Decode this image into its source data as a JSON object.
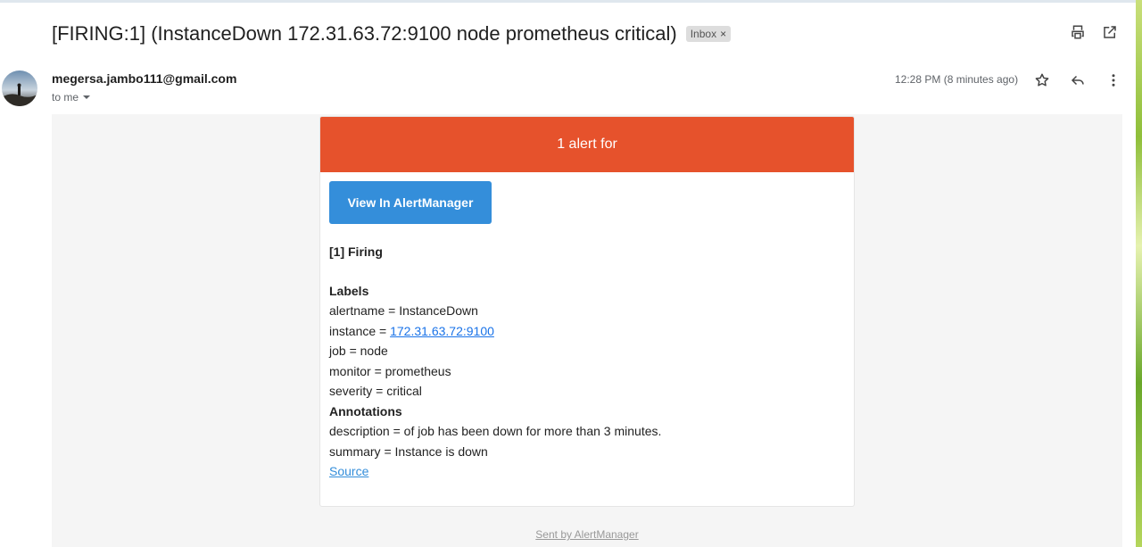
{
  "email": {
    "subject": "[FIRING:1] (InstanceDown 172.31.63.72:9100 node prometheus critical)",
    "label": "Inbox",
    "label_remove": "×",
    "sender": "megersa.jambo111@gmail.com",
    "recipient": "to me",
    "time": "12:28 PM (8 minutes ago)",
    "icons": {
      "print": "print-icon",
      "open_new": "open-in-new-window-icon",
      "star": "star-icon",
      "reply": "reply-icon",
      "more": "more-vert-icon",
      "recipient_dropdown": "caret-down-icon"
    }
  },
  "alert": {
    "header": "1 alert for",
    "header_color": "#e6522c",
    "button_label": "View In AlertManager",
    "button_color": "#348eda",
    "firing_title": "[1] Firing",
    "labels_title": "Labels",
    "labels": {
      "alertname": "alertname = InstanceDown",
      "instance_prefix": "instance = ",
      "instance_link": "172.31.63.72:9100",
      "job": "job = node",
      "monitor": "monitor = prometheus",
      "severity": "severity = critical"
    },
    "annotations_title": "Annotations",
    "annotations": {
      "description": "description = of job has been down for more than 3 minutes.",
      "summary": "summary = Instance is down"
    },
    "source_link": "Source",
    "footer": "Sent by AlertManager"
  }
}
